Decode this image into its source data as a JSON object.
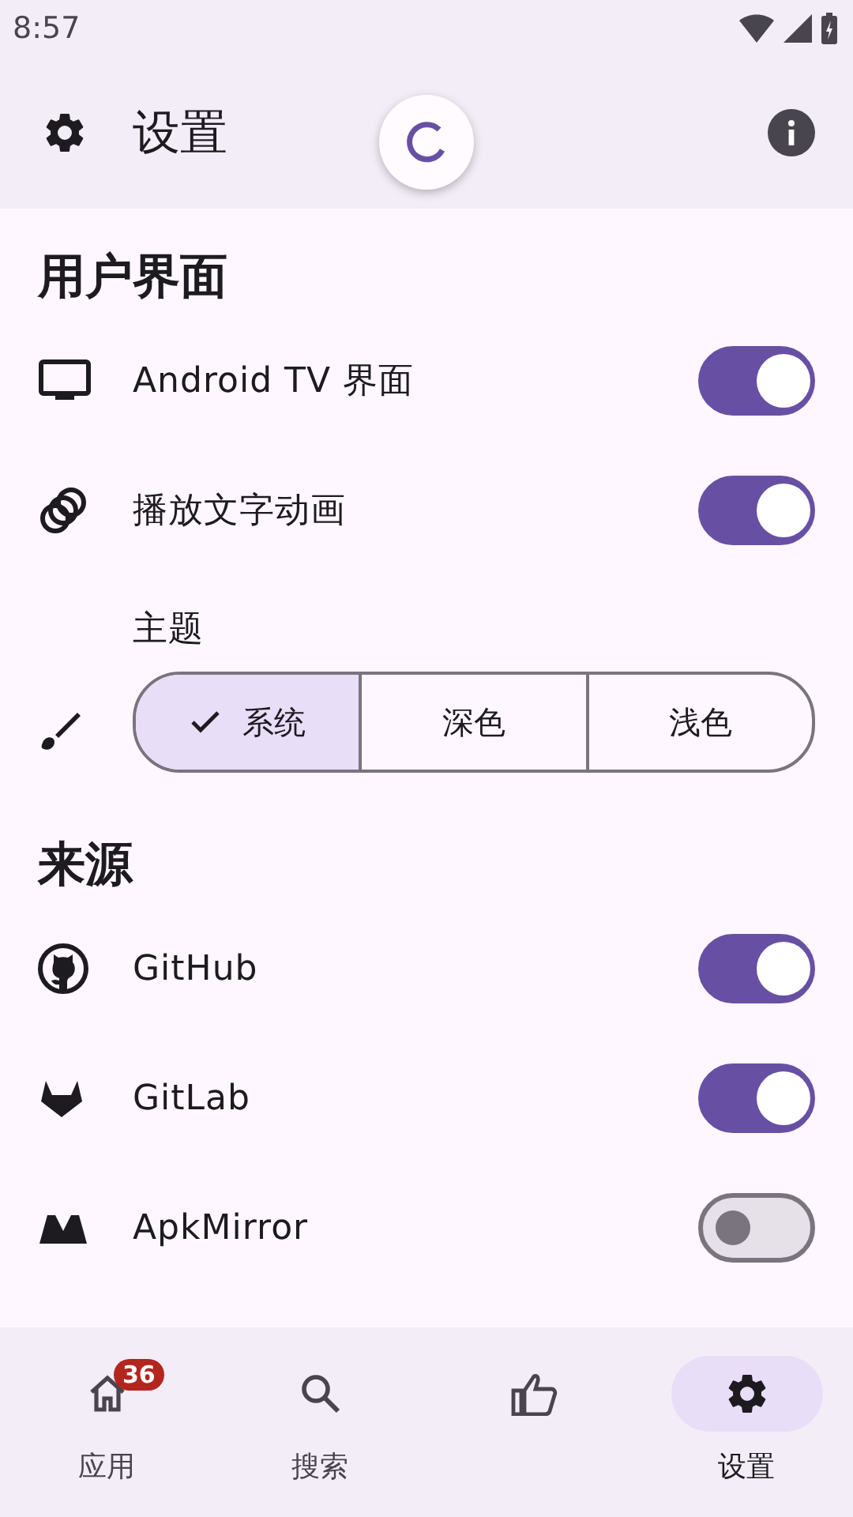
{
  "status_bar": {
    "time": "8:57"
  },
  "top_bar": {
    "title": "设置"
  },
  "sections": [
    {
      "title": "用户界面",
      "items": [
        {
          "kind": "switch",
          "label": "Android TV 界面",
          "on": true
        },
        {
          "kind": "switch",
          "label": "播放文字动画",
          "on": true
        },
        {
          "kind": "segmented",
          "label": "主题",
          "options": [
            {
              "label": "系统",
              "selected": true
            },
            {
              "label": "深色",
              "selected": false
            },
            {
              "label": "浅色",
              "selected": false
            }
          ]
        }
      ]
    },
    {
      "title": "来源",
      "items": [
        {
          "kind": "switch",
          "label": "GitHub",
          "on": true
        },
        {
          "kind": "switch",
          "label": "GitLab",
          "on": true
        },
        {
          "kind": "switch",
          "label": "ApkMirror",
          "on": false
        }
      ]
    }
  ],
  "nav": [
    {
      "label": "应用",
      "badge": "36",
      "selected": false
    },
    {
      "label": "搜索",
      "selected": false
    },
    {
      "selected": false
    },
    {
      "label": "设置",
      "selected": true
    }
  ]
}
